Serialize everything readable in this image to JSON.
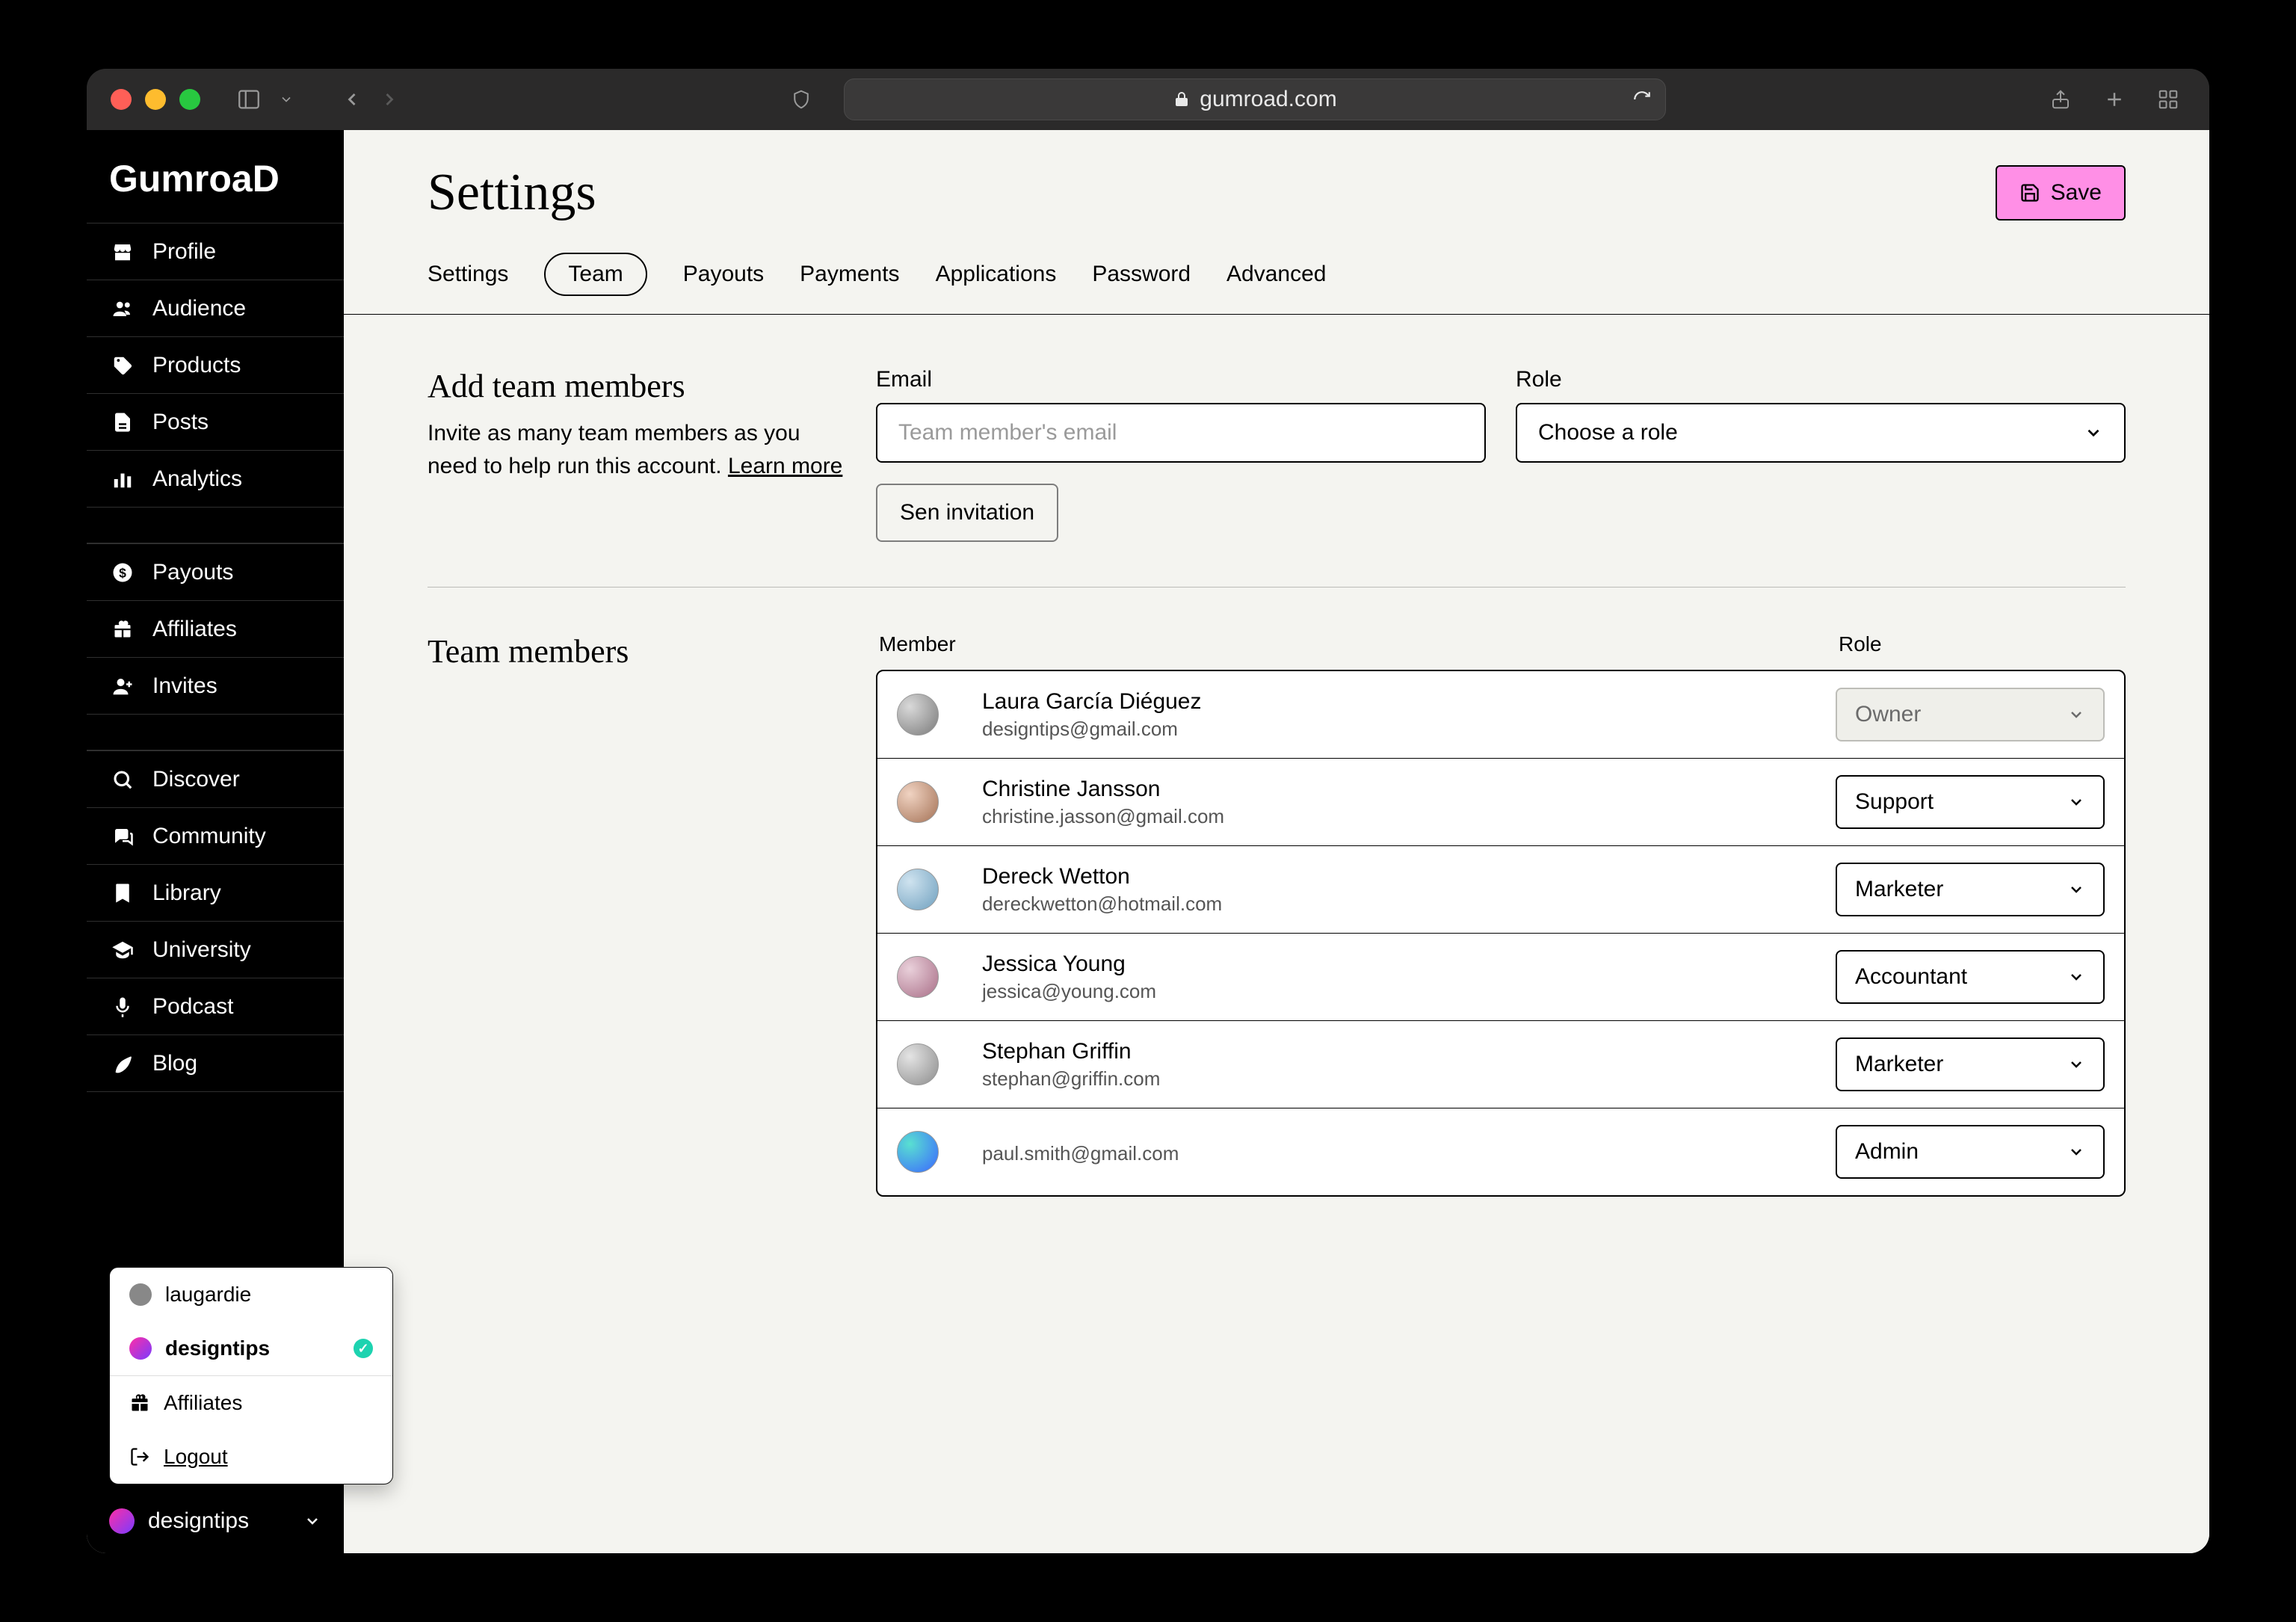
{
  "browser": {
    "url_host": "gumroad.com"
  },
  "logo": "GumroaD",
  "sidebar": {
    "group1": [
      {
        "icon": "store",
        "label": "Profile"
      },
      {
        "icon": "people",
        "label": "Audience"
      },
      {
        "icon": "tag",
        "label": "Products"
      },
      {
        "icon": "file",
        "label": "Posts"
      },
      {
        "icon": "bars",
        "label": "Analytics"
      }
    ],
    "group2": [
      {
        "icon": "dollar",
        "label": "Payouts"
      },
      {
        "icon": "gift",
        "label": "Affiliates"
      },
      {
        "icon": "user-plus",
        "label": "Invites"
      }
    ],
    "group3": [
      {
        "icon": "search",
        "label": "Discover"
      },
      {
        "icon": "chat",
        "label": "Community"
      },
      {
        "icon": "bookmark",
        "label": "Library"
      },
      {
        "icon": "edu",
        "label": "University"
      },
      {
        "icon": "mic",
        "label": "Podcast"
      },
      {
        "icon": "leaf",
        "label": "Blog"
      }
    ],
    "account": "designtips",
    "popover": {
      "u1": "laugardie",
      "u2": "designtips",
      "affiliates": "Affiliates",
      "logout": "Logout"
    }
  },
  "page_title": "Settings",
  "save_label": "Save",
  "tabs": [
    "Settings",
    "Team",
    "Payouts",
    "Payments",
    "Applications",
    "Password",
    "Advanced"
  ],
  "active_tab": "Team",
  "add_section": {
    "title": "Add team members",
    "desc_prefix": "Invite as many team members as you need to help run this account. ",
    "learn_more": "Learn more",
    "email_label": "Email",
    "email_placeholder": "Team member's email",
    "role_label": "Role",
    "role_placeholder": "Choose a role",
    "send_btn": "Sen invitation"
  },
  "members_section": {
    "title": "Team members",
    "col_member": "Member",
    "col_role": "Role",
    "rows": [
      {
        "name": "Laura García Diéguez",
        "email": "designtips@gmail.com",
        "role": "Owner",
        "owner": true,
        "av": "c1"
      },
      {
        "name": "Christine Jansson",
        "email": "christine.jasson@gmail.com",
        "role": "Support",
        "av": "c2"
      },
      {
        "name": "Dereck Wetton",
        "email": "dereckwetton@hotmail.com",
        "role": "Marketer",
        "av": "c3"
      },
      {
        "name": "Jessica Young",
        "email": "jessica@young.com",
        "role": "Accountant",
        "av": "c4"
      },
      {
        "name": "Stephan Griffin",
        "email": "stephan@griffin.com",
        "role": "Marketer",
        "av": "c5"
      },
      {
        "name": "",
        "email": "paul.smith@gmail.com",
        "role": "Admin",
        "av": "c6"
      }
    ]
  }
}
